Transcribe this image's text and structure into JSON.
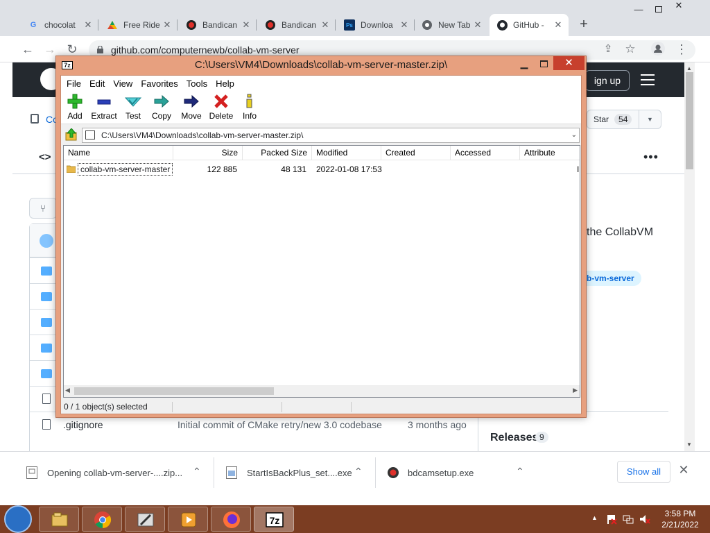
{
  "browser": {
    "tabs": [
      {
        "label": "chocolat",
        "icon": "google-icon"
      },
      {
        "label": "Free Ride",
        "icon": "google-drive-icon"
      },
      {
        "label": "Bandican",
        "icon": "bandicam-icon"
      },
      {
        "label": "Bandican",
        "icon": "bandicam-icon"
      },
      {
        "label": "Downloa",
        "icon": "photoshop-icon"
      },
      {
        "label": "New Tab",
        "icon": "chrome-icon"
      },
      {
        "label": "GitHub -",
        "icon": "github-icon",
        "active": true
      }
    ],
    "url": "github.com/computernewb/collab-vm-server"
  },
  "github": {
    "signup_label": "ign up",
    "repo_fragment": "Co",
    "star_label": "Star",
    "star_count": "54",
    "about_fragment": "the CollabVM",
    "topic_fragment": "b-vm-server",
    "visible_rows": [
      {
        "name": ".gitignore",
        "message": "Initial commit of CMake retry/new 3.0 codebase",
        "time": "3 months ago"
      }
    ],
    "releases_label": "Releases",
    "releases_count": "9"
  },
  "zip_window": {
    "title": "C:\\Users\\VM4\\Downloads\\collab-vm-server-master.zip\\",
    "menu": [
      "File",
      "Edit",
      "View",
      "Favorites",
      "Tools",
      "Help"
    ],
    "toolbar": [
      {
        "label": "Add",
        "icon": "plus-icon"
      },
      {
        "label": "Extract",
        "icon": "minus-icon"
      },
      {
        "label": "Test",
        "icon": "check-icon"
      },
      {
        "label": "Copy",
        "icon": "copy-arrow-icon"
      },
      {
        "label": "Move",
        "icon": "move-arrow-icon"
      },
      {
        "label": "Delete",
        "icon": "delete-x-icon"
      },
      {
        "label": "Info",
        "icon": "info-icon"
      }
    ],
    "path": "C:\\Users\\VM4\\Downloads\\collab-vm-server-master.zip\\",
    "columns": [
      "Name",
      "Size",
      "Packed Size",
      "Modified",
      "Created",
      "Accessed",
      "Attribute"
    ],
    "rows": [
      {
        "name": "collab-vm-server-master",
        "size": "122 885",
        "packed": "48 131",
        "modified": "2022-01-08 17:53",
        "created": "",
        "accessed": "",
        "attr": "I"
      }
    ],
    "status": "0 / 1 object(s) selected"
  },
  "downloads": [
    {
      "label": "Opening collab-vm-server-....zip...",
      "icon": "zip-file-icon"
    },
    {
      "label": "StartIsBackPlus_set....exe",
      "icon": "installer-icon"
    },
    {
      "label": "bdcamsetup.exe",
      "icon": "bandicam-setup-icon"
    }
  ],
  "downloads_show_all": "Show all",
  "taskbar": {
    "time": "3:58 PM",
    "date": "2/21/2022"
  },
  "colors": {
    "zip_frame": "#e7a07f",
    "taskbar": "#7b3d22",
    "close_red": "#c7402d",
    "github_dark": "#24292f"
  }
}
